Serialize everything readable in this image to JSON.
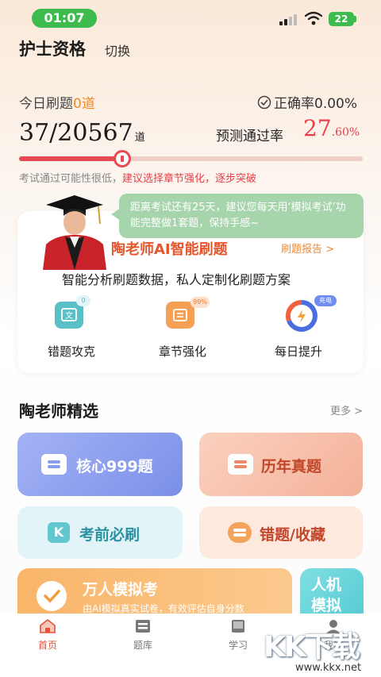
{
  "status_bar": {
    "time": "01:07",
    "battery": "22"
  },
  "header": {
    "title": "护士资格",
    "switch_label": "切换"
  },
  "stats": {
    "today_label": "今日刷题",
    "today_count": "0道",
    "accuracy_label": "正确率0.00%",
    "done": "37/20567",
    "done_unit": "道",
    "predict_label": "预测通过率",
    "predict_main": "27",
    "predict_decimal": ".60%",
    "progress_fraction": 0.3,
    "hint_plain": "考试通过可能性很低，",
    "hint_emph": "建议选择章节强化，逐步突破"
  },
  "ai_card": {
    "bubble": "距离考试还有25天，建议您每天用‘模拟考试’功能完整做1套题，保持手感~",
    "title": "陶老师AI智能刷题",
    "report": "刷题报告 >",
    "subtitle": "智能分析刷题数据，私人定制化刷题方案",
    "features": [
      {
        "label": "错题攻克",
        "badge": "0",
        "icon": "mistake-icon"
      },
      {
        "label": "章节强化",
        "badge": "99%",
        "icon": "chapter-icon"
      },
      {
        "label": "每日提升",
        "badge": "充电",
        "icon": "daily-charge-icon"
      }
    ]
  },
  "selection": {
    "title": "陶老师精选",
    "more": "更多 >",
    "tiles": [
      {
        "label": "核心999题",
        "color": "#8a9cf0"
      },
      {
        "label": "历年真题",
        "color": "#f6b9a2"
      },
      {
        "label": "考前必刷",
        "color": "#dff3f7"
      },
      {
        "label": "错题/收藏",
        "color": "#fce7db"
      }
    ],
    "mock_title": "万人模拟考",
    "mock_sub": "由AI模拟真实试卷，有效评估自身分数",
    "ai_title": "人机模拟"
  },
  "nav": {
    "items": [
      {
        "label": "首页",
        "icon": "home-icon"
      },
      {
        "label": "题库",
        "icon": "question-bank-icon"
      },
      {
        "label": "学习",
        "icon": "book-icon"
      },
      {
        "label": "我的",
        "icon": "profile-icon"
      }
    ]
  },
  "watermark": {
    "text": "KK下载",
    "url": "www.kkx.net"
  },
  "colors": {
    "accent": "#e8404b",
    "orange": "#ef8a2a",
    "green": "#3dbb4d"
  }
}
